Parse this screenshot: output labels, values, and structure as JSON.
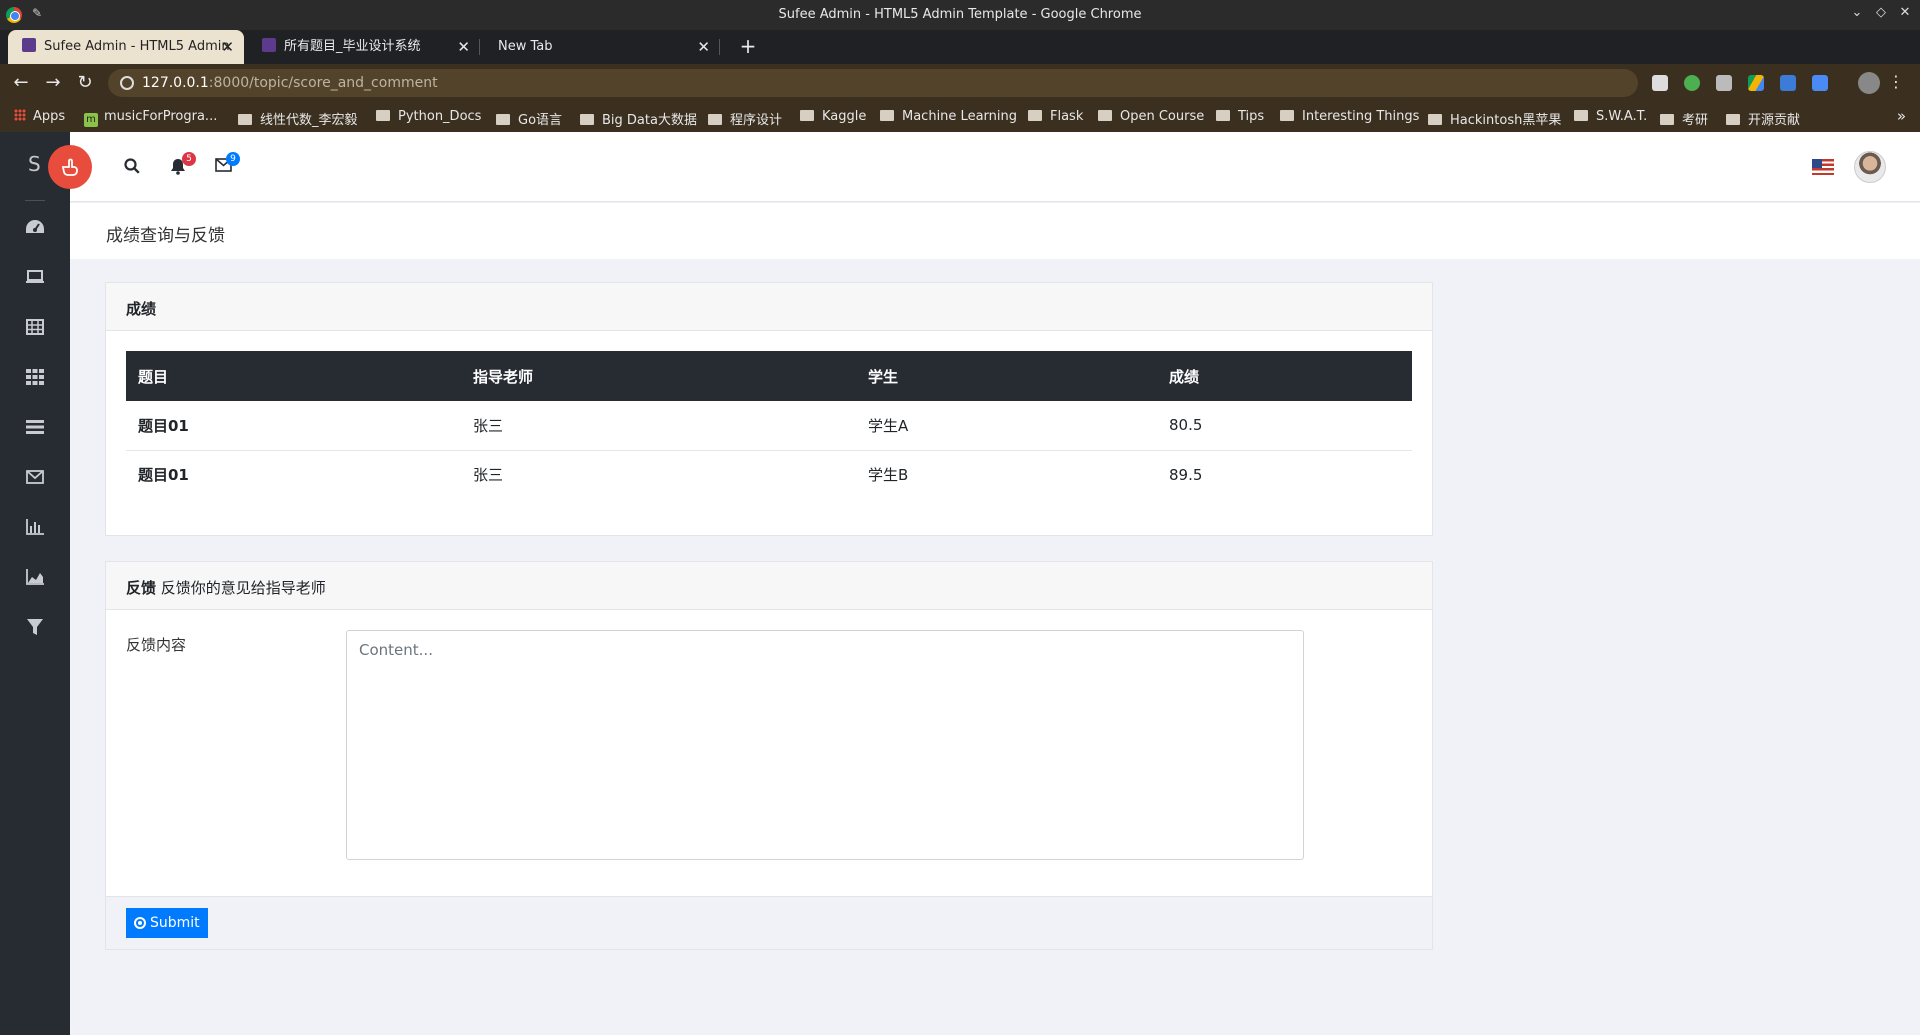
{
  "window": {
    "title": "Sufee Admin - HTML5 Admin Template - Google Chrome"
  },
  "tabs": [
    {
      "label": "Sufee Admin - HTML5 Admin"
    },
    {
      "label": "所有题目_毕业设计系统"
    },
    {
      "label": "New Tab"
    }
  ],
  "address": {
    "host": "127.0.0.1",
    "path": ":8000/topic/score_and_comment"
  },
  "bookmarks": [
    "Apps",
    "musicForProgra...",
    "线性代数_李宏毅",
    "Python_Docs",
    "Go语言",
    "Big Data大数据",
    "程序设计",
    "Kaggle",
    "Machine Learning",
    "Flask",
    "Open Course",
    "Tips",
    "Interesting Things",
    "Hackintosh黑苹果",
    "S.W.A.T.",
    "考研",
    "开源贡献"
  ],
  "sidebar": {
    "brand": "S"
  },
  "header": {
    "notifications_count": "5",
    "messages_count": "9"
  },
  "page": {
    "title": "成绩查询与反馈"
  },
  "scores_card": {
    "title": "成绩",
    "columns": [
      "题目",
      "指导老师",
      "学生",
      "成绩"
    ],
    "rows": [
      [
        "题目01",
        "张三",
        "学生A",
        "80.5"
      ],
      [
        "题目01",
        "张三",
        "学生B",
        "89.5"
      ]
    ]
  },
  "feedback_card": {
    "title_strong": "反馈",
    "title_rest": " 反馈你的意见给指导老师",
    "label": "反馈内容",
    "placeholder": "Content...",
    "value": "",
    "submit_label": "Submit"
  }
}
